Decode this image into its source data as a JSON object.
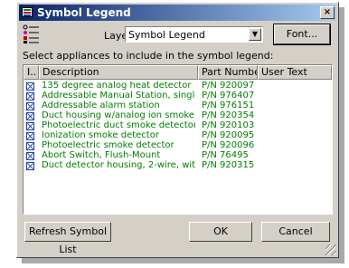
{
  "window": {
    "title": "Symbol Legend",
    "close_glyph": "×"
  },
  "layer": {
    "label": "Layer:",
    "value": "Symbol Legend",
    "dropdown_glyph": "▼"
  },
  "buttons": {
    "font": "Font...",
    "refresh": "Refresh Symbol List",
    "ok": "OK",
    "cancel": "Cancel"
  },
  "instructions": "Select appliances to include in the symbol legend:",
  "table": {
    "columns": [
      "I..",
      "Description",
      "Part Number",
      "User Text"
    ],
    "rows": [
      {
        "checked": true,
        "description": "135 degree analog heat detector",
        "part": "P/N 920097"
      },
      {
        "checked": true,
        "description": "Addressable Manual Station, single a...",
        "part": "P/N 976407"
      },
      {
        "checked": true,
        "description": "Addressable alarm station",
        "part": "P/N 976151"
      },
      {
        "checked": true,
        "description": "Duct housing w/analog ion smoke de...",
        "part": "P/N 920354"
      },
      {
        "checked": true,
        "description": "Photoelectric duct smoke detector",
        "part": "P/N 920103"
      },
      {
        "checked": true,
        "description": "Ionization smoke detector",
        "part": "P/N 920095"
      },
      {
        "checked": true,
        "description": "Photoelectric smoke detector",
        "part": "P/N 920096"
      },
      {
        "checked": true,
        "description": "Abort Switch, Flush-Mount",
        "part": "P/N 76495"
      },
      {
        "checked": true,
        "description": "Duct detector housing, 2-wire, with io...",
        "part": "P/N 920315"
      }
    ]
  },
  "colors": {
    "row_text": "#008000",
    "title_bar": "#0a246a",
    "dialog_bg": "#d4d0c8"
  }
}
